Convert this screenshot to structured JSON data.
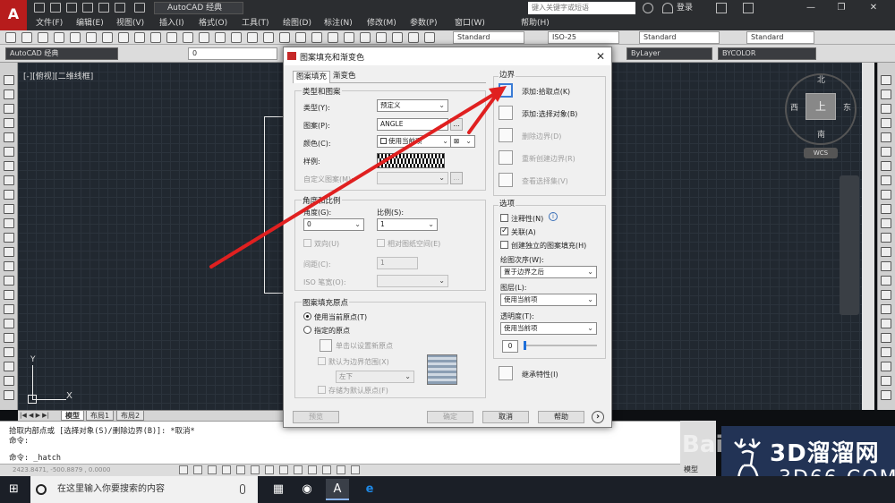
{
  "titlebar": {
    "workspace": "AutoCAD 经典",
    "search_placeholder": "键入关键字或短语",
    "login": "登录",
    "minimize": "—",
    "restore": "❐",
    "close": "✕"
  },
  "menu": [
    "文件(F)",
    "编辑(E)",
    "视图(V)",
    "插入(I)",
    "格式(O)",
    "工具(T)",
    "绘图(D)",
    "标注(N)",
    "修改(M)",
    "参数(P)",
    "窗口(W)",
    "帮助(H)"
  ],
  "toolbar": {
    "text_style": "Standard",
    "dim_style": "ISO-25",
    "table_style": "Standard",
    "mleader_style": "Standard",
    "workspace2": "AutoCAD 经典",
    "layer": "0",
    "linetype": "ByLayer",
    "color": "BYCOLOR"
  },
  "viewport": {
    "label": "[-][俯视][二维线框]",
    "viewcube_face": "上",
    "north": "北",
    "south": "南",
    "east": "东",
    "west": "西",
    "wcs": "WCS",
    "ucs_x": "X",
    "ucs_y": "Y"
  },
  "layout_tabs": [
    "模型",
    "布局1",
    "布局2"
  ],
  "command": {
    "line1": "拾取内部点或 [选择对象(S)/删除边界(B)]:  *取消*",
    "line2": "命令:",
    "prompt": "命令:  _hatch",
    "coords": "2423.8471,  -500.8879 ,  0.0000",
    "model": "模型"
  },
  "taskbar": {
    "search_placeholder": "在这里输入你要搜索的内容"
  },
  "watermark": {
    "text_top": "3D溜溜网",
    "text_bottom": "3D66.COM",
    "baidu": "Bai"
  },
  "dialog": {
    "title": "图案填充和渐变色",
    "close": "✕",
    "tabs": {
      "hatch": "图案填充",
      "gradient": "渐变色"
    },
    "type_pattern": {
      "group": "类型和图案",
      "type_label": "类型(Y):",
      "type_value": "预定义",
      "pattern_label": "图案(P):",
      "pattern_value": "ANGLE",
      "pattern_more": "...",
      "color_label": "颜色(C):",
      "color_value": "使用当前项",
      "sample_label": "样例:",
      "custom_label": "自定义图案(M):",
      "custom_more": "..."
    },
    "angle_scale": {
      "group": "角度和比例",
      "angle_label": "角度(G):",
      "angle_value": "0",
      "scale_label": "比例(S):",
      "scale_value": "1",
      "double_label": "双向(U)",
      "relative_label": "相对图纸空间(E)",
      "spacing_label": "间距(C):",
      "spacing_value": "1",
      "iso_label": "ISO 笔宽(O):"
    },
    "origin": {
      "group": "图案填充原点",
      "use_current": "使用当前原点(T)",
      "specified": "指定的原点",
      "click_set": "单击以设置新原点",
      "default_extent": "默认为边界范围(X)",
      "position": "左下",
      "store_default": "存储为默认原点(F)"
    },
    "boundaries": {
      "group": "边界",
      "add_pick": "添加:拾取点(K)",
      "add_select": "添加:选择对象(B)",
      "remove": "删除边界(D)",
      "recreate": "重新创建边界(R)",
      "view_sel": "查看选择集(V)"
    },
    "options": {
      "group": "选项",
      "annotative": "注释性(N)",
      "associative": "关联(A)",
      "separate": "创建独立的图案填充(H)",
      "draw_order_label": "绘图次序(W):",
      "draw_order": "置于边界之后",
      "layer_label": "图层(L):",
      "layer_value": "使用当前项",
      "transparency_label": "透明度(T):",
      "transparency_value": "使用当前项",
      "transparency_level": "0"
    },
    "inherit": "继承特性(I)",
    "buttons": {
      "preview": "预览",
      "ok": "确定",
      "cancel": "取消",
      "help": "帮助",
      "more": "›"
    }
  },
  "colors": {
    "annotation_red": "#e02020",
    "autocad_red": "#b71c1c"
  }
}
